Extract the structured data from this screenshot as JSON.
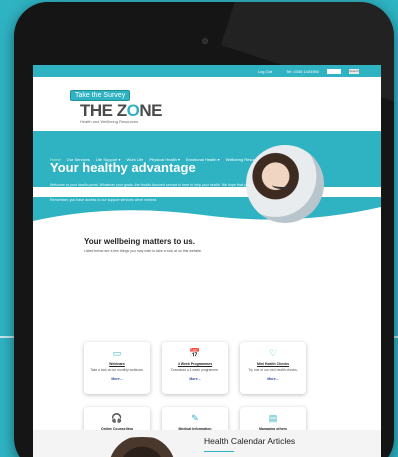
{
  "topbar": {
    "login": "Log Out",
    "phone": "Tel: 0345 1434950",
    "search_placeholder": "",
    "search_button": "Search"
  },
  "header": {
    "survey_button": "Take the Survey",
    "logo_text_1": "THE Z",
    "logo_o": "O",
    "logo_text_2": "NE",
    "logo_sub": "Health and Wellbeing Resources"
  },
  "nav": {
    "items": [
      "Home",
      "Our Services",
      "Life Support ▾",
      "Work Life",
      "Physical Health ▾",
      "Emotional Health ▾",
      "Wellbeing Resources ▾",
      "Contact Us"
    ]
  },
  "hero": {
    "title": "Your healthy advantage",
    "text": "Welcome to your health portal. Whatever your goals, the Health Assured service is here to help your health. We hope that you find the resources available to you useful.",
    "text2": "Remember, you have access to our support services when needed."
  },
  "wellbeing": {
    "title": "Your wellbeing matters to us.",
    "subtitle": "Listed below are a few things you may wish to take a look at on this website."
  },
  "cards": [
    {
      "icon": "▭",
      "title": "Webinars",
      "desc": "Take a look at our monthly webinars.",
      "more": "More..."
    },
    {
      "icon": "📅",
      "title": "4 Week Programmes",
      "desc": "Download a 4 week programme.",
      "more": "More..."
    },
    {
      "icon": "♡",
      "title": "Mini Health Checks",
      "desc": "Try one of our mini health checks.",
      "more": "More..."
    },
    {
      "icon": "🎧",
      "title": "Online Counselling",
      "desc": "Try Cognitive Behavioural Therapy.",
      "more": "More..."
    },
    {
      "icon": "✎",
      "title": "Medical Information",
      "desc": "Links to validated external sites.",
      "more": "More..."
    },
    {
      "icon": "▤",
      "title": "Managing others",
      "desc": "Managing staff wellbeing articles.",
      "more": "More..."
    }
  ],
  "calendar": {
    "title": "Health Calendar Articles"
  }
}
